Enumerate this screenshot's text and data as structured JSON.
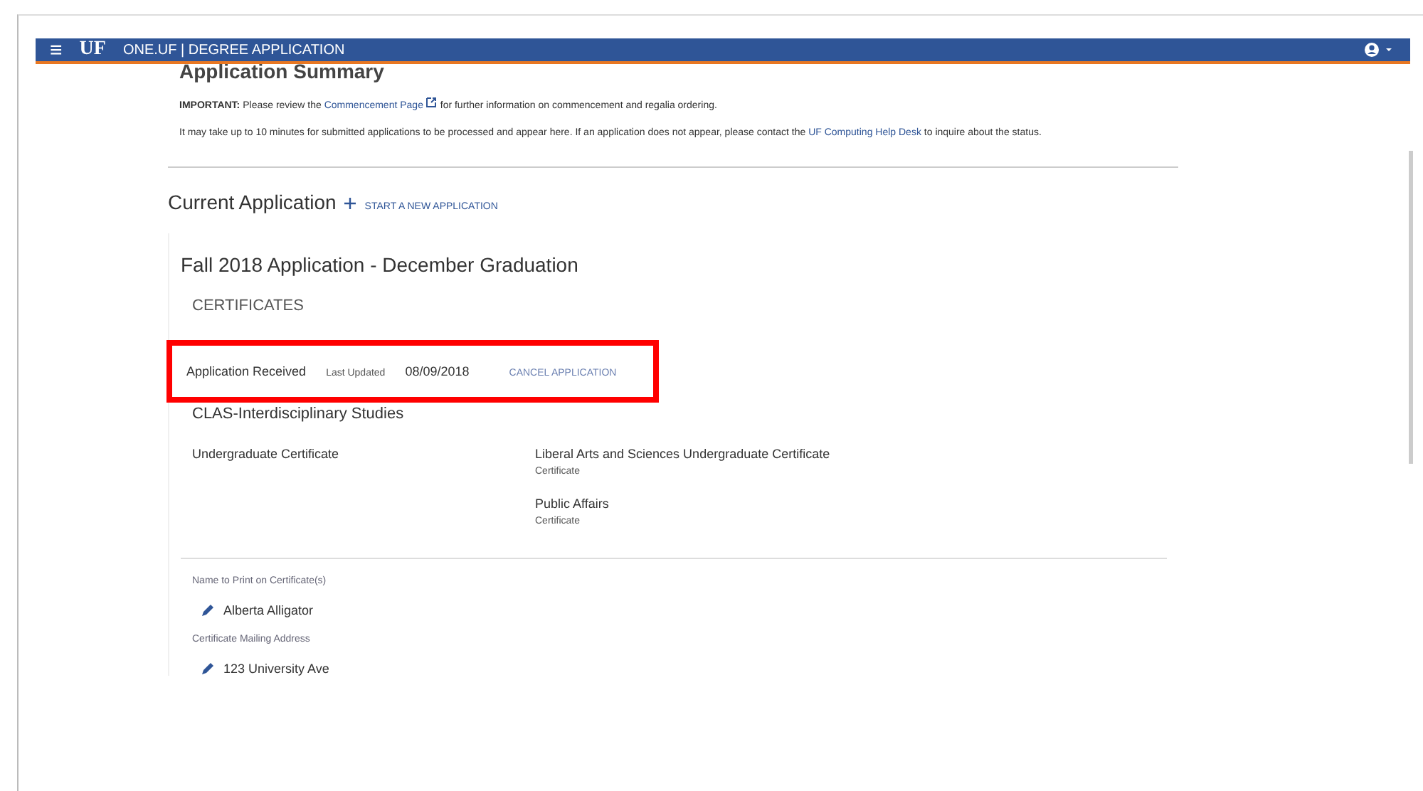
{
  "header": {
    "menu_icon": "≡",
    "logo": "UF",
    "title": "ONE.UF | DEGREE APPLICATION"
  },
  "summary": {
    "heading": "Application Summary",
    "notice": "**IMPORTANT:** Please review the",
    "link": "Commencement Page",
    "notice_end": "for further information on commencement and regalia ordering.",
    "processing": "It may take up to 10 minutes for submitted applications to be processed and appear here. If an application does not appear, please contact the",
    "help_link": "UF Computing Help Desk",
    "processing_end": "to inquire about the status."
  },
  "current": {
    "heading": "Current Application",
    "start_link": "START A NEW APPLICATION"
  },
  "application": {
    "title": "Fall 2018 Application - December Graduation",
    "section": "CERTIFICATES",
    "status": "Application Received",
    "updated_label": "Last Updated",
    "updated_date": "08/09/2018",
    "cancel": "CANCEL APPLICATION",
    "highlighted": true,
    "program": "CLAS-Interdisciplinary Studies",
    "type": "Undergraduate Certificate",
    "certificates": [
      {
        "name": "Liberal Arts and Sciences Undergraduate Certificate",
        "kind": "Certificate"
      },
      {
        "name": "Public Affairs",
        "kind": "Certificate"
      }
    ],
    "name_label": "Name to Print on Certificate(s)",
    "name_value": "Alberta Alligator",
    "address_label": "Certificate Mailing Address",
    "address_value": "123 University Ave"
  }
}
